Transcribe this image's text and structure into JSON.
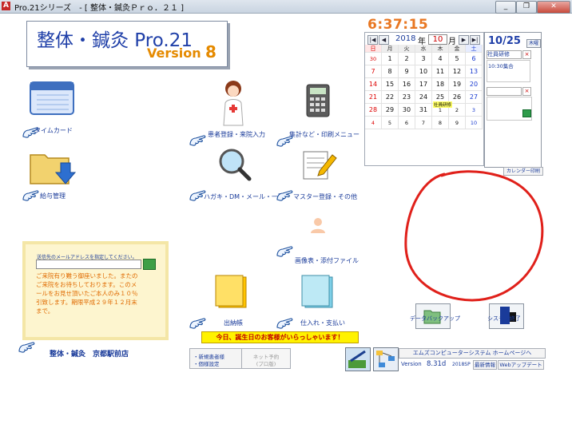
{
  "window": {
    "title": "Pro.21シリーズ　- [ 整体・鍼灸Ｐｒｏ．２１ ]",
    "app_icon": "A",
    "minimize": "_",
    "restore": "❐",
    "close": "✕"
  },
  "logo": {
    "title": "整体・鍼灸 Pro.21",
    "version_label": "Version",
    "version_number": "8"
  },
  "menu": {
    "timecard": "タイムカード",
    "payroll": "給与管理",
    "patient": "患者登録・来院入力",
    "stats": "集計など・印刷メニュー",
    "postcard": "ハガキ・DM・メール・一覧",
    "master": "マスター登録・その他",
    "image": "画像表・添付ファイル",
    "accounting": "出納帳",
    "purchase": "仕入れ・支払い"
  },
  "clock": "6:37:15",
  "calendar": {
    "year": "2018",
    "year_suffix": "年",
    "month": "10",
    "month_suffix": "月",
    "weekdays": [
      "日",
      "月",
      "火",
      "水",
      "木",
      "金",
      "土"
    ],
    "weeks": [
      [
        "30",
        "1",
        "2",
        "3",
        "4",
        "5",
        "6"
      ],
      [
        "7",
        "8",
        "9",
        "10",
        "11",
        "12",
        "13"
      ],
      [
        "14",
        "15",
        "16",
        "17",
        "18",
        "19",
        "20"
      ],
      [
        "21",
        "22",
        "23",
        "24",
        "25",
        "26",
        "27"
      ],
      [
        "28",
        "29",
        "30",
        "31",
        "1",
        "2",
        "3"
      ],
      [
        "4",
        "5",
        "6",
        "7",
        "8",
        "9",
        "10"
      ]
    ],
    "event_tag": "社員研修",
    "prev_year": "|◀",
    "prev_month": "◀",
    "next_month": "▶",
    "next_year": "▶|"
  },
  "event_panel": {
    "date": "10/25",
    "weekday": "木曜",
    "title": "社員研修",
    "entry": "10:30集合",
    "calendar_button": "カレンダー印刷"
  },
  "mail": {
    "prompt": "送信先のメールアドレスを指定してください。",
    "message": "ご来院有り難う御座いました。またのご来院をお待ちしております。このメールをお見せ頂いたご本人のみ１０％引致します。期限平成２９年１２月末まで。",
    "clinic_name": "整体・鍼灸　京都駅前店"
  },
  "banner": "今日、誕生日のお客様がいらっしゃいます！",
  "buttons": {
    "new_patient": "・新規患者様",
    "reservation_change": "・個様設定",
    "net_booking": "ネット予約",
    "net_booking_sub": "(プロ版)",
    "backup": "データバックアップ",
    "exit": "システム終了",
    "homepage": "エムズコンピューターシステム ホームページへ",
    "latest_info": "最新情報",
    "web_update": "Webアップデート"
  },
  "version": {
    "label": "Version",
    "number": "8.31d",
    "sp": "2018SP"
  }
}
